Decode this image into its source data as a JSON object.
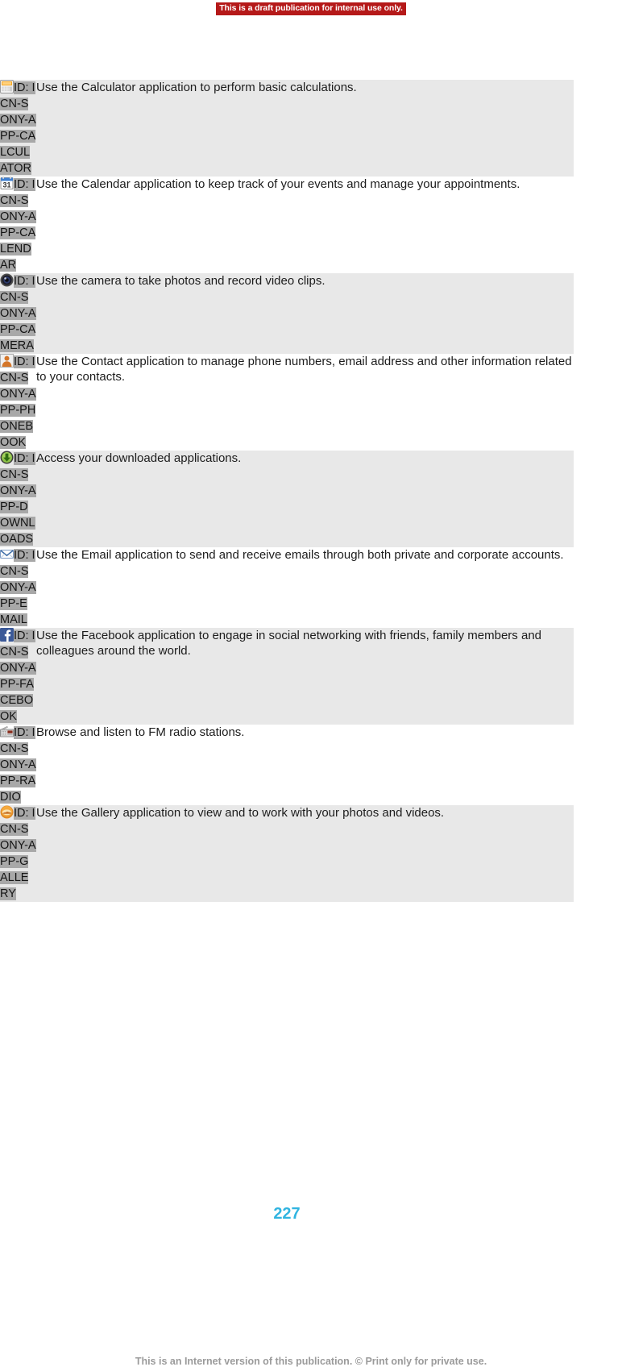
{
  "banner": {
    "text": "This is a draft publication for internal use only."
  },
  "page": {
    "number": "227",
    "footer": "This is an Internet version of this publication. © Print only for private use."
  },
  "table": {
    "rows": [
      {
        "icon": "calculator-icon",
        "id_prefix": "ID:",
        "id_value": "ICN-SONY-APP-CALCULATOR",
        "description": "Use the Calculator application to perform basic calculations.",
        "shaded": true
      },
      {
        "icon": "calendar-icon",
        "id_prefix": "ID:",
        "id_value": "ICN-SONY-APP-CALENDAR",
        "description": "Use the Calendar application to keep track of your events and manage your appointments.",
        "shaded": false
      },
      {
        "icon": "camera-icon",
        "id_prefix": "ID:",
        "id_value": "ICN-SONY-APP-CAMERA",
        "description": "Use the camera to take photos and record video clips.",
        "shaded": true
      },
      {
        "icon": "phonebook-icon",
        "id_prefix": "ID:",
        "id_value": "ICN-SONY-APP-PHONEBOOK",
        "description": "Use the Contact application to manage phone numbers, email address and other information related to your contacts.",
        "shaded": false
      },
      {
        "icon": "downloads-icon",
        "id_prefix": "ID:",
        "id_value": "ICN-SONY-APP-DOWNLOADS",
        "description": "Access your downloaded applications.",
        "shaded": true
      },
      {
        "icon": "email-icon",
        "id_prefix": "ID:",
        "id_value": "ICN-SONY-APP-EMAIL",
        "description": "Use the Email application to send and receive emails through both private and corporate accounts.",
        "shaded": false
      },
      {
        "icon": "facebook-icon",
        "id_prefix": "ID:",
        "id_value": "ICN-SONY-APP-FACEBOOK",
        "description": "Use the Facebook application to engage in social networking with friends, family members and colleagues around the world.",
        "shaded": true
      },
      {
        "icon": "radio-icon",
        "id_prefix": "ID:",
        "id_value": "ICN-SONY-APP-RADIO",
        "description": "Browse and listen to FM radio stations.",
        "shaded": false
      },
      {
        "icon": "gallery-icon",
        "id_prefix": "ID:",
        "id_value": "ICN-SONY-APP-GALLERY",
        "description": "Use the Gallery application to view and to work with your photos and videos.",
        "shaded": true
      }
    ]
  },
  "colors": {
    "banner_bg": "#b51919",
    "row_shaded": "#e8e8e8",
    "highlight": "#a8a8a8",
    "page_number": "#30b4e0",
    "footer_text": "#9b9b9b"
  }
}
